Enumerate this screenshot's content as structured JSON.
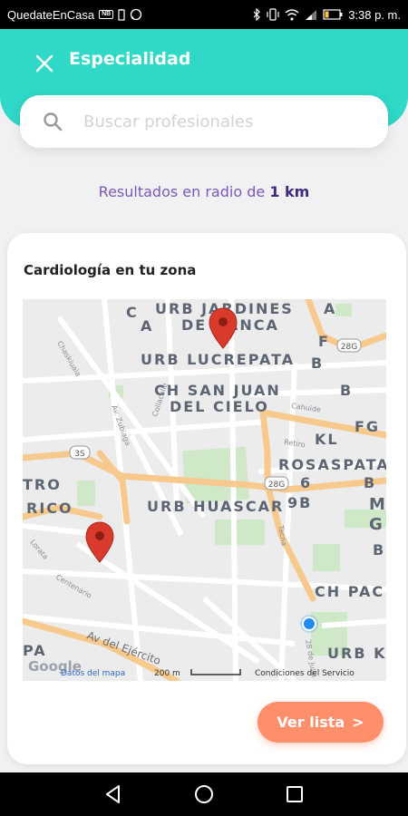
{
  "status_bar": {
    "app_name": "QuedateEnCasa",
    "badge": "NB",
    "time": "3:38 p. m."
  },
  "header": {
    "title": "Especialidad"
  },
  "search": {
    "placeholder": "Buscar profesionales"
  },
  "results": {
    "prefix": "Resultados en radio de",
    "radius": "1 km"
  },
  "card": {
    "title": "Cardiología en tu zona",
    "button_label": "Ver lista",
    "button_chevron": ">"
  },
  "map": {
    "labels": {
      "urb_jardines": "URB JARDINES",
      "de_banca": "DE BANCA",
      "c": "C",
      "a_left": "A",
      "a_right": "A",
      "urb_lucrepata": "URB LUCREPATA",
      "f": "F",
      "b_top": "B",
      "ch_san_juan": "CH SAN JUAN",
      "del_cielo": "DEL CIELO",
      "b_mid": "B",
      "kl": "KL",
      "fg": "FG",
      "rosaspata": "ROSASPATA",
      "six": "6",
      "b_right": "B",
      "nine_b": "9B",
      "m": "M",
      "g": "G",
      "tro": "TRO",
      "rico": "RICO",
      "urb_huascar": "URB HUASCAR",
      "b_low": "B",
      "ch_pac": "CH PAC",
      "pa": "PA",
      "urb_k": "URB K",
      "street_chaski": "Chaskiuaia",
      "street_zubioga": "Av. Zubiaga",
      "street_collacalle": "Collacalle",
      "street_cahuide": "Cahuide",
      "street_retiro": "Retiro",
      "street_tacna": "Tacna",
      "street_centenario": "Centenario",
      "street_lorata": "Lorata",
      "street_dejulio": "28 de Julio",
      "av_ejercito": "Av del Ejército",
      "road_28g_a": "28G",
      "road_28g_b": "28G",
      "road_3s": "3S"
    },
    "footer": {
      "google": "Google",
      "datos": "Datos del mapa",
      "scale": "200 m",
      "conditions": "Condiciones del Servicio"
    },
    "colors": {
      "base": "#ececec",
      "road_major": "#f7c98c",
      "road_minor": "#ffffff",
      "park": "#cfe8c8",
      "marker": "#d93a2b",
      "user_dot": "#1f8cf4"
    }
  },
  "colors": {
    "header": "#2fd8c7",
    "accent_purple": "#7b59b8",
    "button": "#ff8f6b"
  }
}
